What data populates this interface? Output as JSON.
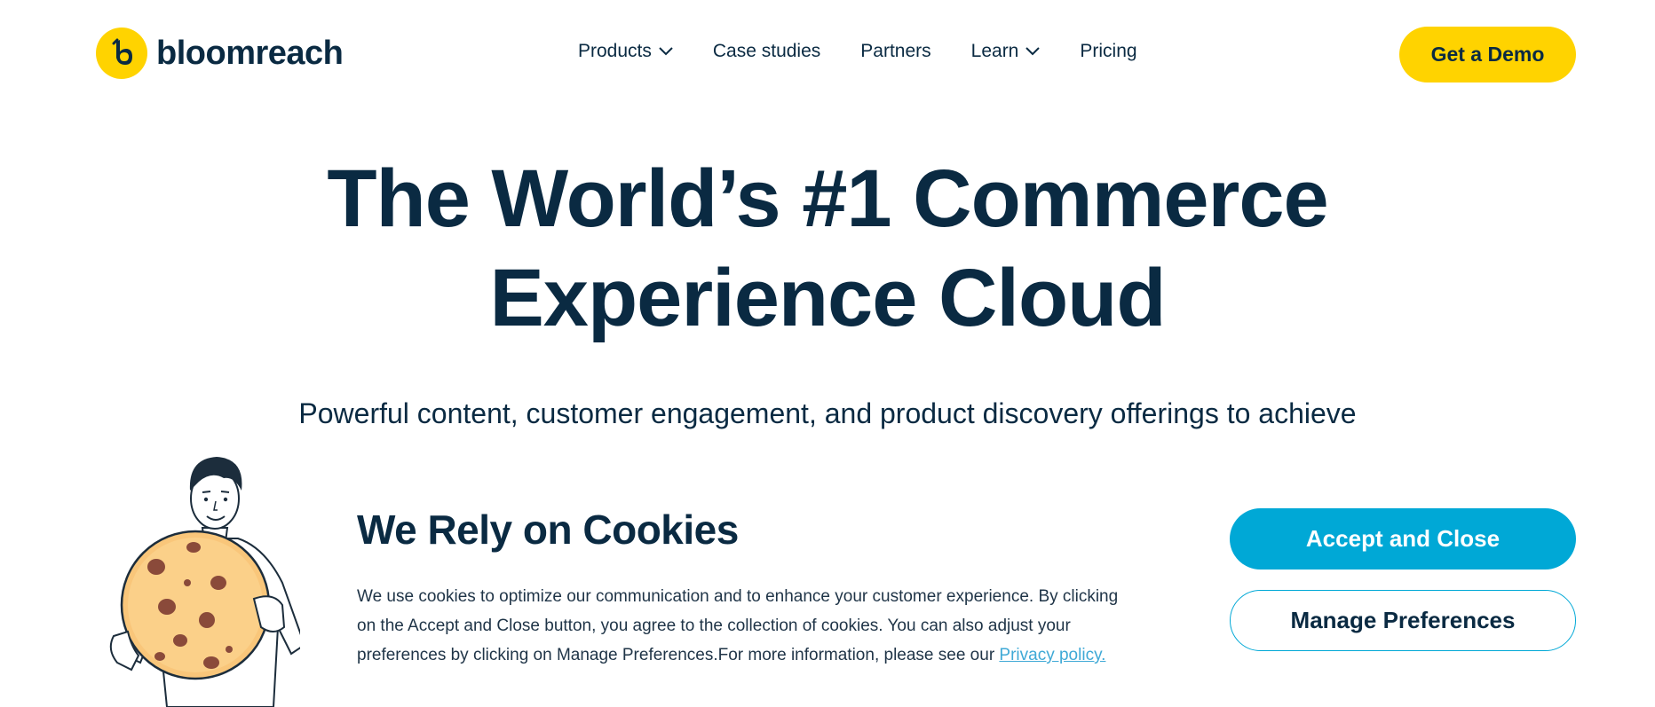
{
  "header": {
    "brand": "bloomreach",
    "nav": [
      {
        "label": "Products",
        "has_dropdown": true
      },
      {
        "label": "Case studies",
        "has_dropdown": false
      },
      {
        "label": "Partners",
        "has_dropdown": false
      },
      {
        "label": "Learn",
        "has_dropdown": true
      },
      {
        "label": "Pricing",
        "has_dropdown": false
      }
    ],
    "cta_label": "Get a Demo"
  },
  "hero": {
    "title_line1": "The World’s #1 Commerce",
    "title_line2": "Experience Cloud",
    "subtitle": "Powerful content, customer engagement, and product discovery offerings to achieve"
  },
  "cookie_banner": {
    "title": "We Rely on Cookies",
    "text": "We use cookies to optimize our communication and to enhance your customer experience. By clicking on the Accept and Close button, you agree to the collection of cookies. You can also adjust your preferences by clicking on Manage Preferences.For more information, please see our ",
    "privacy_link": "Privacy policy.",
    "accept_label": "Accept and Close",
    "manage_label": "Manage Preferences"
  },
  "colors": {
    "brand_yellow": "#ffd300",
    "navy": "#0a2a42",
    "accent_blue": "#00a8d6",
    "link_blue": "#3fa9d6"
  },
  "icons": {
    "logo": "bloomreach-b-logo",
    "dropdown": "chevron-down-icon",
    "illustration": "man-holding-cookie"
  }
}
